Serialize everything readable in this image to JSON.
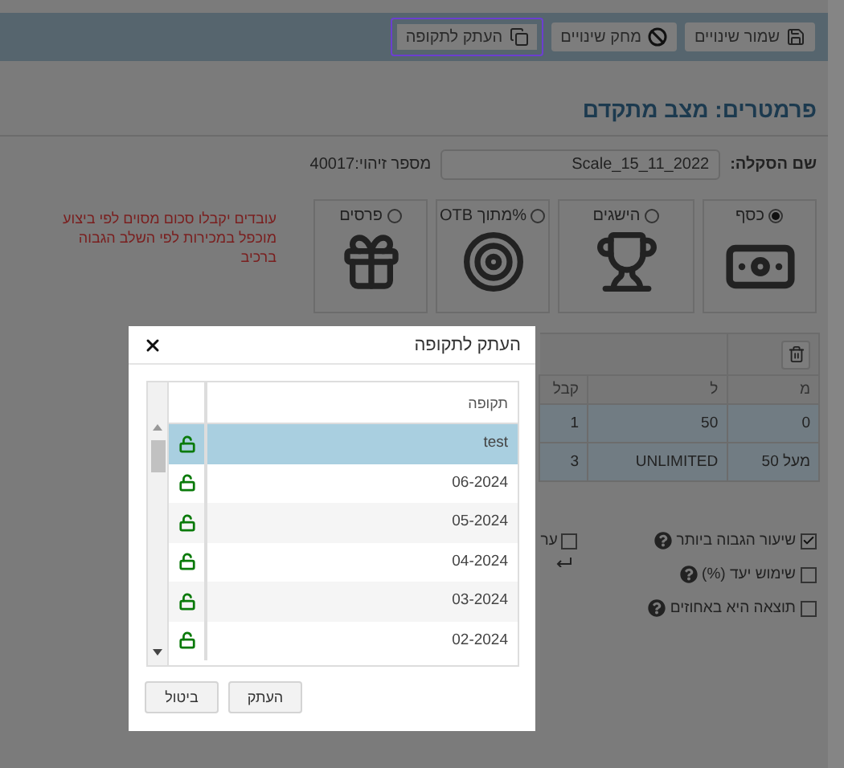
{
  "toolbar": {
    "buttons": [
      {
        "label": "שמור שינויים",
        "focused": false
      },
      {
        "label": "מחק שינויים",
        "focused": false
      },
      {
        "label": "העתק לתקופה",
        "focused": true
      }
    ]
  },
  "title": "פרמטרים: מצב מתקדם",
  "scale": {
    "label": "שם הסקלה:",
    "value": "Scale_15_11_2022",
    "id_text": "מספר זיהוי:40017"
  },
  "reward_types": [
    {
      "label": "כסף",
      "selected": true
    },
    {
      "label": "הישגים",
      "selected": false
    },
    {
      "label": "%מתוך OTB",
      "selected": false
    },
    {
      "label": "פרסים",
      "selected": false
    }
  ],
  "description": "עובדים יקבלו סכום מסוים לפי ביצוע מוכפל במכירות לפי השלב הגבוה ברכיב",
  "range_table": {
    "columns": [
      "מ",
      "ל",
      "קבל"
    ],
    "rows": [
      [
        "0",
        "50",
        "1"
      ],
      [
        "מעל 50",
        "UNLIMITED",
        "3"
      ]
    ]
  },
  "side_option": {
    "label": "ער",
    "checked": false
  },
  "options": [
    {
      "label": "שיעור הגבוה ביותר",
      "checked": true
    },
    {
      "label": "שימוש יעד (%)",
      "checked": false
    },
    {
      "label": "תוצאה היא באחוזים",
      "checked": false
    }
  ],
  "dialog": {
    "title": "העתק לתקופה",
    "column": "תקופה",
    "periods": [
      {
        "name": "test",
        "selected": true,
        "locked": false
      },
      {
        "name": "06-2024",
        "selected": false,
        "locked": false
      },
      {
        "name": "05-2024",
        "selected": false,
        "locked": false
      },
      {
        "name": "04-2024",
        "selected": false,
        "locked": false
      },
      {
        "name": "03-2024",
        "selected": false,
        "locked": false
      },
      {
        "name": "02-2024",
        "selected": false,
        "locked": false
      }
    ],
    "buttons": [
      "העתק",
      "ביטול"
    ]
  }
}
